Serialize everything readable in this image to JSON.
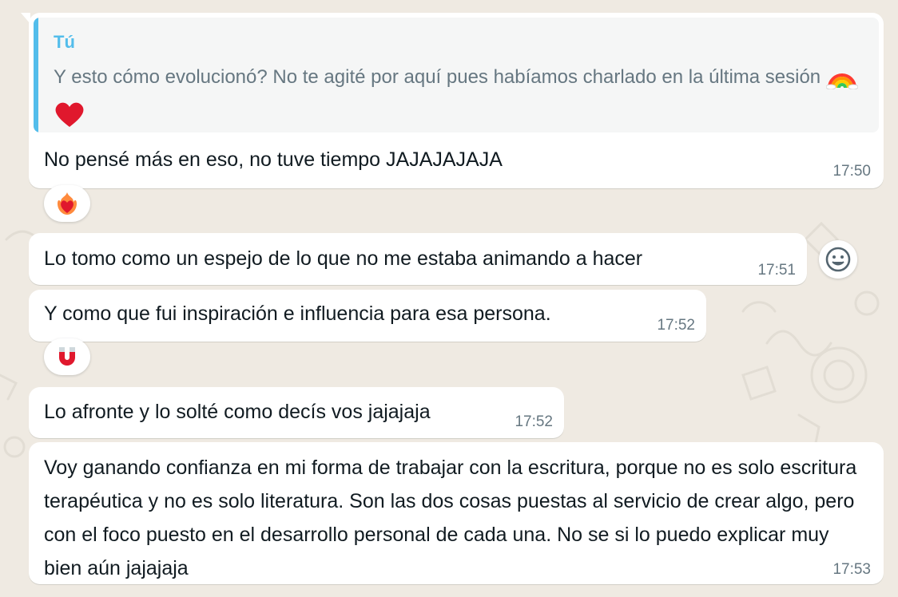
{
  "quoted": {
    "author": "Tú",
    "text": "Y esto cómo evolucionó? No te agité por aquí pues habíamos charlado en la última sesión"
  },
  "messages": [
    {
      "text": "No pensé más en eso, no tuve tiempo JAJAJAJAJA",
      "time": "17:50",
      "reaction": "heart-on-fire"
    },
    {
      "text": "Lo tomo como un espejo de lo que no me estaba animando a hacer",
      "time": "17:51"
    },
    {
      "text": "Y como que fui inspiración e influencia para esa persona.",
      "time": "17:52",
      "reaction": "magnet"
    },
    {
      "text": "Lo afronte y lo solté como decís vos jajajaja",
      "time": "17:52"
    },
    {
      "text": "Voy ganando confianza en mi forma de trabajar con la escritura, porque no es solo escritura terapéutica y no es solo literatura. Son las dos cosas puestas al servicio de crear algo, pero con el foco puesto en el desarrollo personal de cada una. No se si lo puedo explicar muy bien aún jajajaja",
      "time": "17:53"
    }
  ],
  "icons": {
    "quote_emojis": [
      "rainbow-icon",
      "red-heart-icon"
    ],
    "hover_action": "emoji-react-icon"
  },
  "colors": {
    "chat_background": "#efeae2",
    "bubble": "#ffffff",
    "quote_accent": "#53bdeb",
    "timestamp": "#667781"
  }
}
